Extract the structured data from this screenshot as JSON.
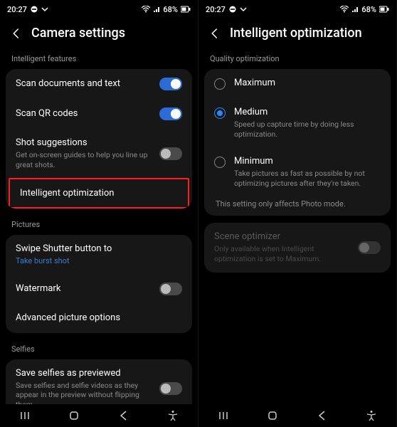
{
  "status": {
    "time": "20:27",
    "battery": "68%"
  },
  "left": {
    "title": "Camera settings",
    "sec_intelligent": "Intelligent features",
    "scan_docs": "Scan documents and text",
    "scan_qr": "Scan QR codes",
    "shot_suggestions": "Shot suggestions",
    "shot_suggestions_sub": "Get on-screen guides to help you line up great shots.",
    "intelligent_opt": "Intelligent optimization",
    "sec_pictures": "Pictures",
    "swipe_shutter": "Swipe Shutter button to",
    "swipe_shutter_link": "Take burst shot",
    "watermark": "Watermark",
    "advanced": "Advanced picture options",
    "sec_selfies": "Selfies",
    "save_selfies": "Save selfies as previewed",
    "save_selfies_sub": "Save selfies and selfie videos as they appear in the preview without flipping them."
  },
  "right": {
    "title": "Intelligent optimization",
    "sec_quality": "Quality optimization",
    "opt_max": "Maximum",
    "opt_med": "Medium",
    "opt_med_sub": "Speed up capture time by doing less optimization.",
    "opt_min": "Minimum",
    "opt_min_sub": "Take pictures as fast as possible by not optimizing pictures after they're taken.",
    "note": "This setting only affects Photo mode.",
    "scene_opt": "Scene optimizer",
    "scene_opt_sub": "Only available when Intelligent optimization is set to Maximum."
  }
}
